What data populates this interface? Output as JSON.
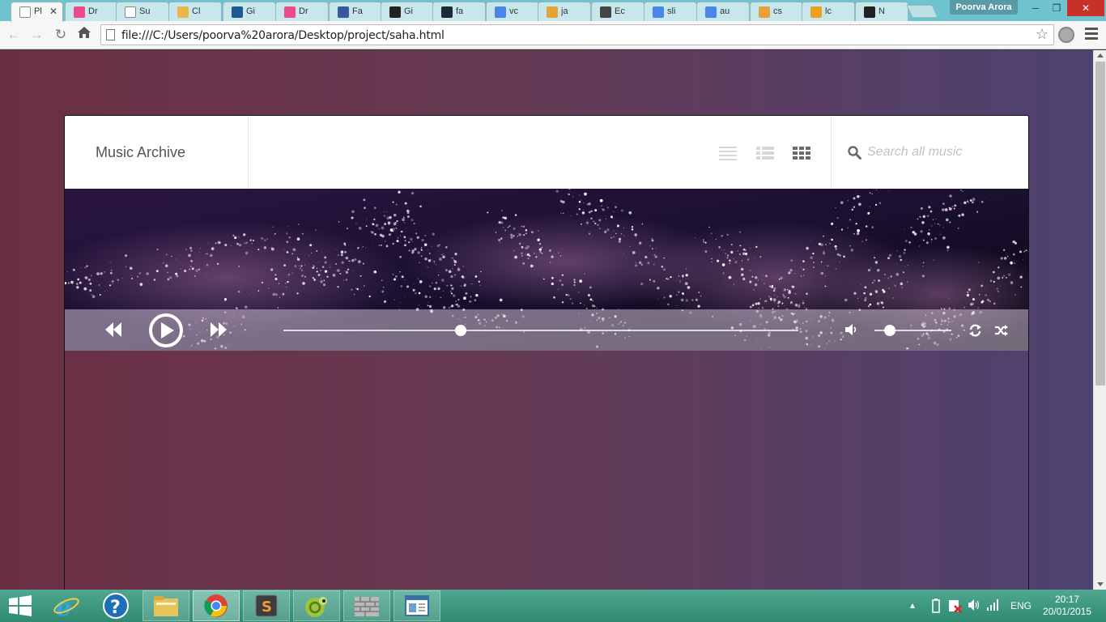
{
  "browser": {
    "tabs": [
      {
        "label": "Pl",
        "favicon": "page-icon",
        "color": "#ffffff",
        "active": true
      },
      {
        "label": "Dr",
        "favicon": "dribbble-icon",
        "color": "#ea4c89"
      },
      {
        "label": "Su",
        "favicon": "page-icon",
        "color": "#ffffff"
      },
      {
        "label": "Cl",
        "favicon": "clef-icon",
        "color": "#e8b84a"
      },
      {
        "label": "Gi",
        "favicon": "ds-icon",
        "color": "#1f5a92"
      },
      {
        "label": "Dr",
        "favicon": "dribbble-icon",
        "color": "#ea4c89"
      },
      {
        "label": "Fa",
        "favicon": "facebook-icon",
        "color": "#3b5998"
      },
      {
        "label": "Gi",
        "favicon": "github-icon",
        "color": "#222222"
      },
      {
        "label": "fa",
        "favicon": "flag-icon",
        "color": "#1c2a3a"
      },
      {
        "label": "vc",
        "favicon": "google-icon",
        "color": "#4a86e8"
      },
      {
        "label": "ja",
        "favicon": "stackoverflow-icon",
        "color": "#e5a13a"
      },
      {
        "label": "Ec",
        "favicon": "cloud-icon",
        "color": "#444444"
      },
      {
        "label": "sli",
        "favicon": "google-icon",
        "color": "#4a86e8"
      },
      {
        "label": "au",
        "favicon": "google-icon",
        "color": "#4a86e8"
      },
      {
        "label": "cs",
        "favicon": "stackoverflow-icon",
        "color": "#e5a13a"
      },
      {
        "label": "lc",
        "favicon": "asterisk-icon",
        "color": "#f0a020"
      },
      {
        "label": "N",
        "favicon": "github-icon",
        "color": "#222222"
      }
    ],
    "profile_name": "Poorva Arora",
    "url": "file:///C:/Users/poorva%20arora/Desktop/project/saha.html"
  },
  "app": {
    "brand": "Music Archive",
    "views": [
      "list-view-icon",
      "detail-view-icon",
      "grid-view-icon"
    ],
    "active_view": "grid-view-icon",
    "search_placeholder": "Search all music"
  },
  "player": {
    "progress": 0.345,
    "volume": 0.2,
    "controls": [
      "rewind-icon",
      "play-icon",
      "fast-forward-icon",
      "volume-icon",
      "repeat-icon",
      "shuffle-icon"
    ]
  },
  "taskbar": {
    "apps": [
      "windows-start-icon",
      "internet-explorer-icon",
      "help-icon",
      "file-explorer-icon",
      "chrome-icon",
      "sublime-text-icon",
      "chameleon-app-icon",
      "firewall-icon",
      "window-app-icon"
    ],
    "language": "ENG",
    "time": "20:17",
    "date": "20/01/2015"
  },
  "colors": {
    "bg_left": "#6b2f43",
    "bg_right": "#4d4271",
    "tabbar": "#6ec3cf",
    "taskbar": "#3a9a80"
  }
}
